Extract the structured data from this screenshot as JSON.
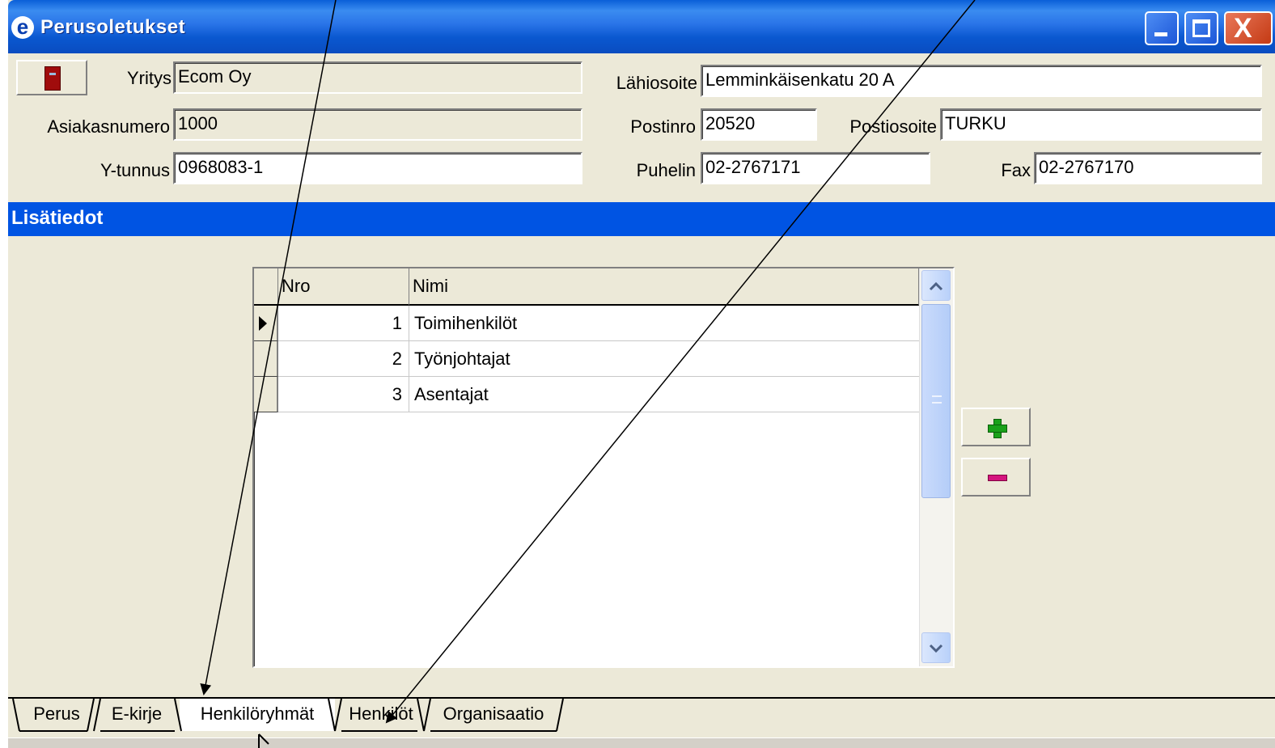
{
  "window": {
    "title": "Perusoletukset",
    "app_icon_letter": "e",
    "close_glyph": "X"
  },
  "form": {
    "yritys_label": "Yritys",
    "yritys_value": "Ecom Oy",
    "asiakasnumero_label": "Asiakasnumero",
    "asiakasnumero_value": "1000",
    "ytunnus_label": "Y-tunnus",
    "ytunnus_value": "0968083-1",
    "lahiosoite_label": "Lähiosoite",
    "lahiosoite_value": "Lemminkäisenkatu 20 A",
    "postinro_label": "Postinro",
    "postinro_value": "20520",
    "postiosoite_label": "Postiosoite",
    "postiosoite_value": "TURKU",
    "puhelin_label": "Puhelin",
    "puhelin_value": "02-2767171",
    "fax_label": "Fax",
    "fax_value": "02-2767170"
  },
  "section": {
    "title": "Lisätiedot"
  },
  "grid": {
    "columns": [
      "Nro",
      "Nimi"
    ],
    "rows": [
      {
        "nro": "1",
        "nimi": "Toimihenkilöt"
      },
      {
        "nro": "2",
        "nimi": "Työnjohtajat"
      },
      {
        "nro": "3",
        "nimi": "Asentajat"
      }
    ],
    "current_row": 0,
    "scroll_up_glyph": "⌃",
    "scroll_down_glyph": "⌄"
  },
  "tabs": [
    {
      "label": "Perus"
    },
    {
      "label": "E-kirje"
    },
    {
      "label": "Henkilöryhmät",
      "active": true
    },
    {
      "label": "Henkilöt"
    },
    {
      "label": "Organisaatio"
    }
  ],
  "colors": {
    "titlebar": "#0a58d0",
    "section_header": "#0054e3",
    "window_face": "#ece9d8",
    "add_icon": "#1aa11a",
    "remove_icon": "#d4157e"
  },
  "icons": {
    "app": "app-e-icon",
    "exit": "door-exit-icon",
    "add": "plus-icon",
    "remove": "minus-icon"
  }
}
